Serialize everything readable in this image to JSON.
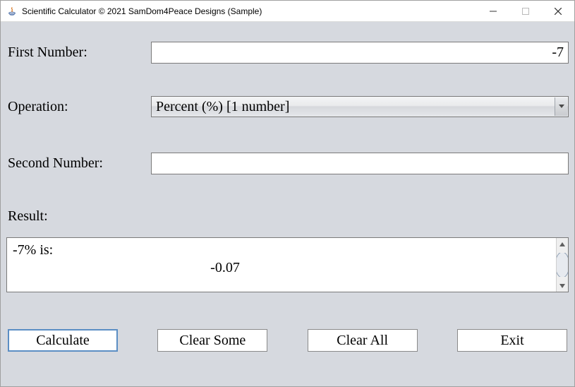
{
  "window": {
    "title": "Scientific Calculator © 2021 SamDom4Peace Designs (Sample)"
  },
  "labels": {
    "first_number": "First Number:",
    "operation": "Operation:",
    "second_number": "Second Number:",
    "result": "Result:"
  },
  "fields": {
    "first_number_value": "-7",
    "operation_selected": "Percent (%) [1 number]",
    "second_number_value": ""
  },
  "result": {
    "line1": "-7% is:",
    "line2": "-0.07"
  },
  "buttons": {
    "calculate": "Calculate",
    "clear_some": "Clear Some",
    "clear_all": "Clear All",
    "exit": "Exit"
  }
}
